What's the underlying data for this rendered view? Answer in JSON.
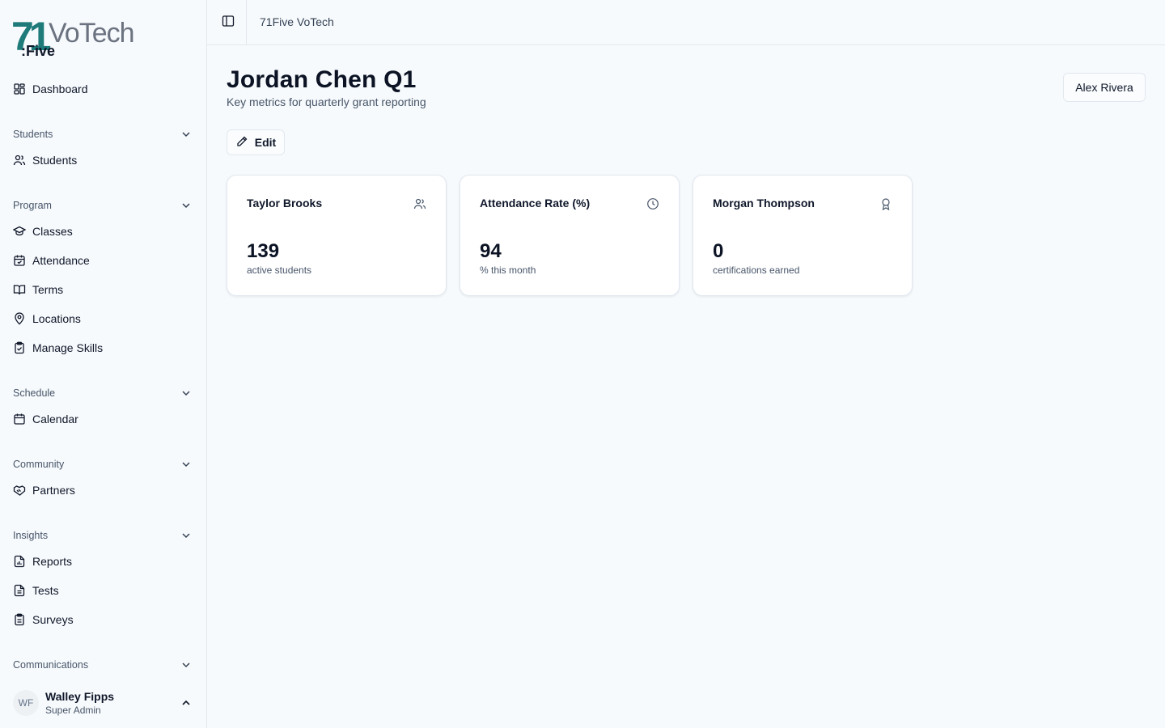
{
  "brand": {
    "logo_numeral": "71",
    "logo_word": "VoTech",
    "logo_sub": ":Five",
    "accent_color": "#1f7a7a"
  },
  "sidebar": {
    "dashboard": {
      "label": "Dashboard",
      "icon": "dashboard-icon"
    },
    "groups": [
      {
        "label": "Students",
        "items": [
          {
            "label": "Students",
            "icon": "users-icon"
          }
        ]
      },
      {
        "label": "Program",
        "items": [
          {
            "label": "Classes",
            "icon": "graduation-cap-icon"
          },
          {
            "label": "Attendance",
            "icon": "calendar-check-icon"
          },
          {
            "label": "Terms",
            "icon": "book-open-icon"
          },
          {
            "label": "Locations",
            "icon": "map-pin-icon"
          },
          {
            "label": "Manage Skills",
            "icon": "clipboard-check-icon"
          }
        ]
      },
      {
        "label": "Schedule",
        "items": [
          {
            "label": "Calendar",
            "icon": "calendar-icon"
          }
        ]
      },
      {
        "label": "Community",
        "items": [
          {
            "label": "Partners",
            "icon": "handshake-icon"
          }
        ]
      },
      {
        "label": "Insights",
        "items": [
          {
            "label": "Reports",
            "icon": "file-chart-icon"
          },
          {
            "label": "Tests",
            "icon": "file-text-icon"
          },
          {
            "label": "Surveys",
            "icon": "clipboard-list-icon"
          }
        ]
      },
      {
        "label": "Communications",
        "items": []
      }
    ],
    "user": {
      "initials": "WF",
      "name": "Walley Fipps",
      "role": "Super Admin"
    }
  },
  "topbar": {
    "breadcrumb": "71Five VoTech"
  },
  "main": {
    "title": "Jordan Chen Q1",
    "subtitle": "Key metrics for quarterly grant reporting",
    "user_button": "Alex Rivera",
    "edit_label": "Edit",
    "cards": [
      {
        "title": "Taylor Brooks",
        "value": "139",
        "note": "active students",
        "icon": "users-icon"
      },
      {
        "title": "Attendance Rate (%)",
        "value": "94",
        "note": "% this month",
        "icon": "clock-icon"
      },
      {
        "title": "Morgan Thompson",
        "value": "0",
        "note": "certifications earned",
        "icon": "award-icon"
      }
    ]
  }
}
